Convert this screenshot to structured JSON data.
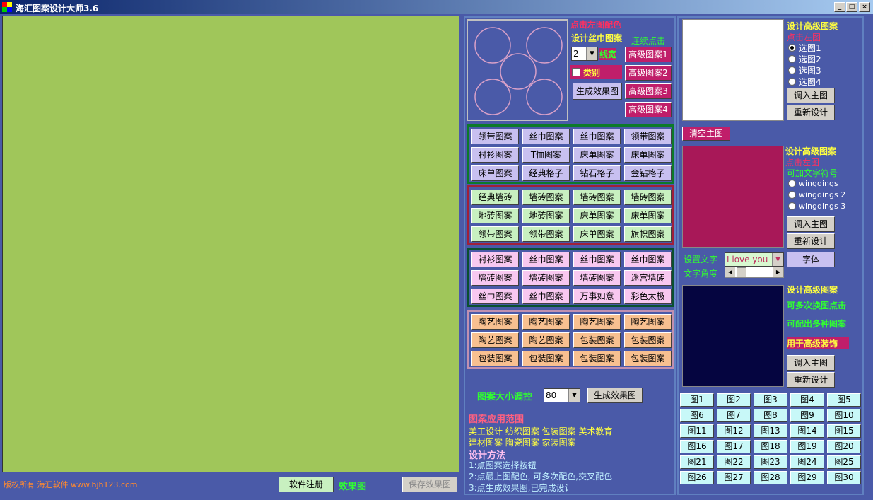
{
  "window": {
    "title": "海汇图案设计大师3.6",
    "min": "_",
    "max": "□",
    "close": "×"
  },
  "preview": {
    "click_hint": "点击左图配色",
    "design_label": "设计丝巾图案",
    "continuous": "连续点击",
    "line_width_value": "2",
    "line_width_label": "线宽",
    "category_label": "类别",
    "generate": "生成效果图",
    "advanced": [
      "高级图案1",
      "高级图案2",
      "高级图案3",
      "高级图案4"
    ]
  },
  "groups": [
    {
      "style": "b-lav",
      "border": "#0c7a2a",
      "buttons": [
        "领带图案",
        "丝巾图案",
        "丝巾图案",
        "领带图案",
        "衬衫图案",
        "T恤图案",
        "床单图案",
        "床单图案",
        "床单图案",
        "经典格子",
        "钻石格子",
        "金钻格子"
      ]
    },
    {
      "style": "b-grn",
      "border": "#a0203a",
      "buttons": [
        "经典墙砖",
        "墙砖图案",
        "墙砖图案",
        "墙砖图案",
        "地砖图案",
        "地砖图案",
        "床单图案",
        "床单图案",
        "领带图案",
        "领带图案",
        "床单图案",
        "旗帜图案"
      ]
    },
    {
      "style": "b-pnk",
      "border": "#0a5030",
      "buttons": [
        "衬衫图案",
        "丝巾图案",
        "丝巾图案",
        "丝巾图案",
        "墙砖图案",
        "墙砖图案",
        "墙砖图案",
        "迷宫墙砖",
        "丝巾图案",
        "丝巾图案",
        "万事如意",
        "彩色太极"
      ]
    },
    {
      "style": "b-org",
      "border": "#c090b0",
      "buttons": [
        "陶艺图案",
        "陶艺图案",
        "陶艺图案",
        "陶艺图案",
        "陶艺图案",
        "陶艺图案",
        "包装图案",
        "包装图案",
        "包装图案",
        "包装图案",
        "包装图案",
        "包装图案"
      ]
    }
  ],
  "size_control": {
    "label": "图案大小调控",
    "value": "80",
    "generate": "生成效果图"
  },
  "info": {
    "scope_title": "图案应用范围",
    "scope_line1": "美工设计  纺织图案  包装图案  美术教育",
    "scope_line2": "建材图案  陶瓷图案  家装图案",
    "method_title": "设计方法",
    "step1": "1:点图案选择按钮",
    "step2": "2:点最上图配色, 可多次配色,交叉配色",
    "step3": "3:点生成效果图,已完成设计"
  },
  "adv1": {
    "title": "设计高级图案",
    "sub": "点击左图",
    "options": [
      "选图1",
      "选图2",
      "选图3",
      "选图4"
    ],
    "selected": 0,
    "load": "调入主图",
    "redesign": "重新设计"
  },
  "clear_main": "清空主图",
  "adv2": {
    "title": "设计高级图案",
    "sub": "点击左图",
    "extra": "可加文字符号",
    "options": [
      "wingdings",
      "wingdings 2",
      "wingdings 3"
    ],
    "load": "调入主图",
    "redesign": "重新设计"
  },
  "text_settings": {
    "set_text": "设置文字",
    "text_value": "I love you",
    "angle": "文字角度",
    "font_button": "字体"
  },
  "adv3": {
    "title": "设计高级图案",
    "line1": "可多次换图点击",
    "line2": "可配出多种图案",
    "line3": "用于高级装饰",
    "load": "调入主图",
    "redesign": "重新设计"
  },
  "thumbs": [
    "图1",
    "图2",
    "图3",
    "图4",
    "图5",
    "图6",
    "图7",
    "图8",
    "图9",
    "图10",
    "图11",
    "图12",
    "图13",
    "图14",
    "图15",
    "图16",
    "图17",
    "图18",
    "图19",
    "图20",
    "图21",
    "图22",
    "图23",
    "图24",
    "图25",
    "图26",
    "图27",
    "图28",
    "图29",
    "图30"
  ],
  "footer": {
    "copyright": "版权所有 海汇软件 www.hjh123.com",
    "register": "软件注册",
    "effect_label": "效果图",
    "save": "保存效果图"
  },
  "colors": {
    "bg": "#4a5aa8",
    "canvas": "#a0c65a",
    "magenta": "#c01e6a",
    "dark_navy": "#050540"
  }
}
